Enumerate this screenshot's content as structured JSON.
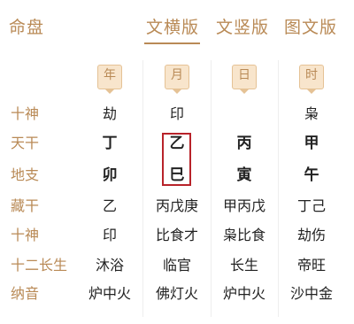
{
  "header": {
    "app_title": "命盘",
    "tabs": [
      {
        "label": "文横版",
        "active": true
      },
      {
        "label": "文竖版",
        "active": false
      },
      {
        "label": "图文版",
        "active": false
      }
    ]
  },
  "pillars": [
    "年",
    "月",
    "日",
    "时"
  ],
  "rows": [
    {
      "label": "十神",
      "cells": [
        "劫",
        "印",
        "",
        "枭"
      ],
      "bold": false
    },
    {
      "label": "天干",
      "cells": [
        "丁",
        "乙",
        "丙",
        "甲"
      ],
      "bold": true
    },
    {
      "label": "地支",
      "cells": [
        "卯",
        "巳",
        "寅",
        "午"
      ],
      "bold": true
    },
    {
      "label": "藏干",
      "cells": [
        "乙",
        "丙戊庚",
        "甲丙戊",
        "丁己"
      ],
      "bold": false
    },
    {
      "label": "十神",
      "cells": [
        "印",
        "比食才",
        "枭比食",
        "劫伤"
      ],
      "bold": false
    },
    {
      "label": "十二长生",
      "cells": [
        "沐浴",
        "临官",
        "长生",
        "帝旺"
      ],
      "bold": false
    },
    {
      "label": "纳音",
      "cells": [
        "炉中火",
        "佛灯火",
        "炉中火",
        "沙中金"
      ],
      "bold": false
    }
  ],
  "colors": {
    "accent": "#b98a56",
    "highlight": "#b8232a"
  }
}
